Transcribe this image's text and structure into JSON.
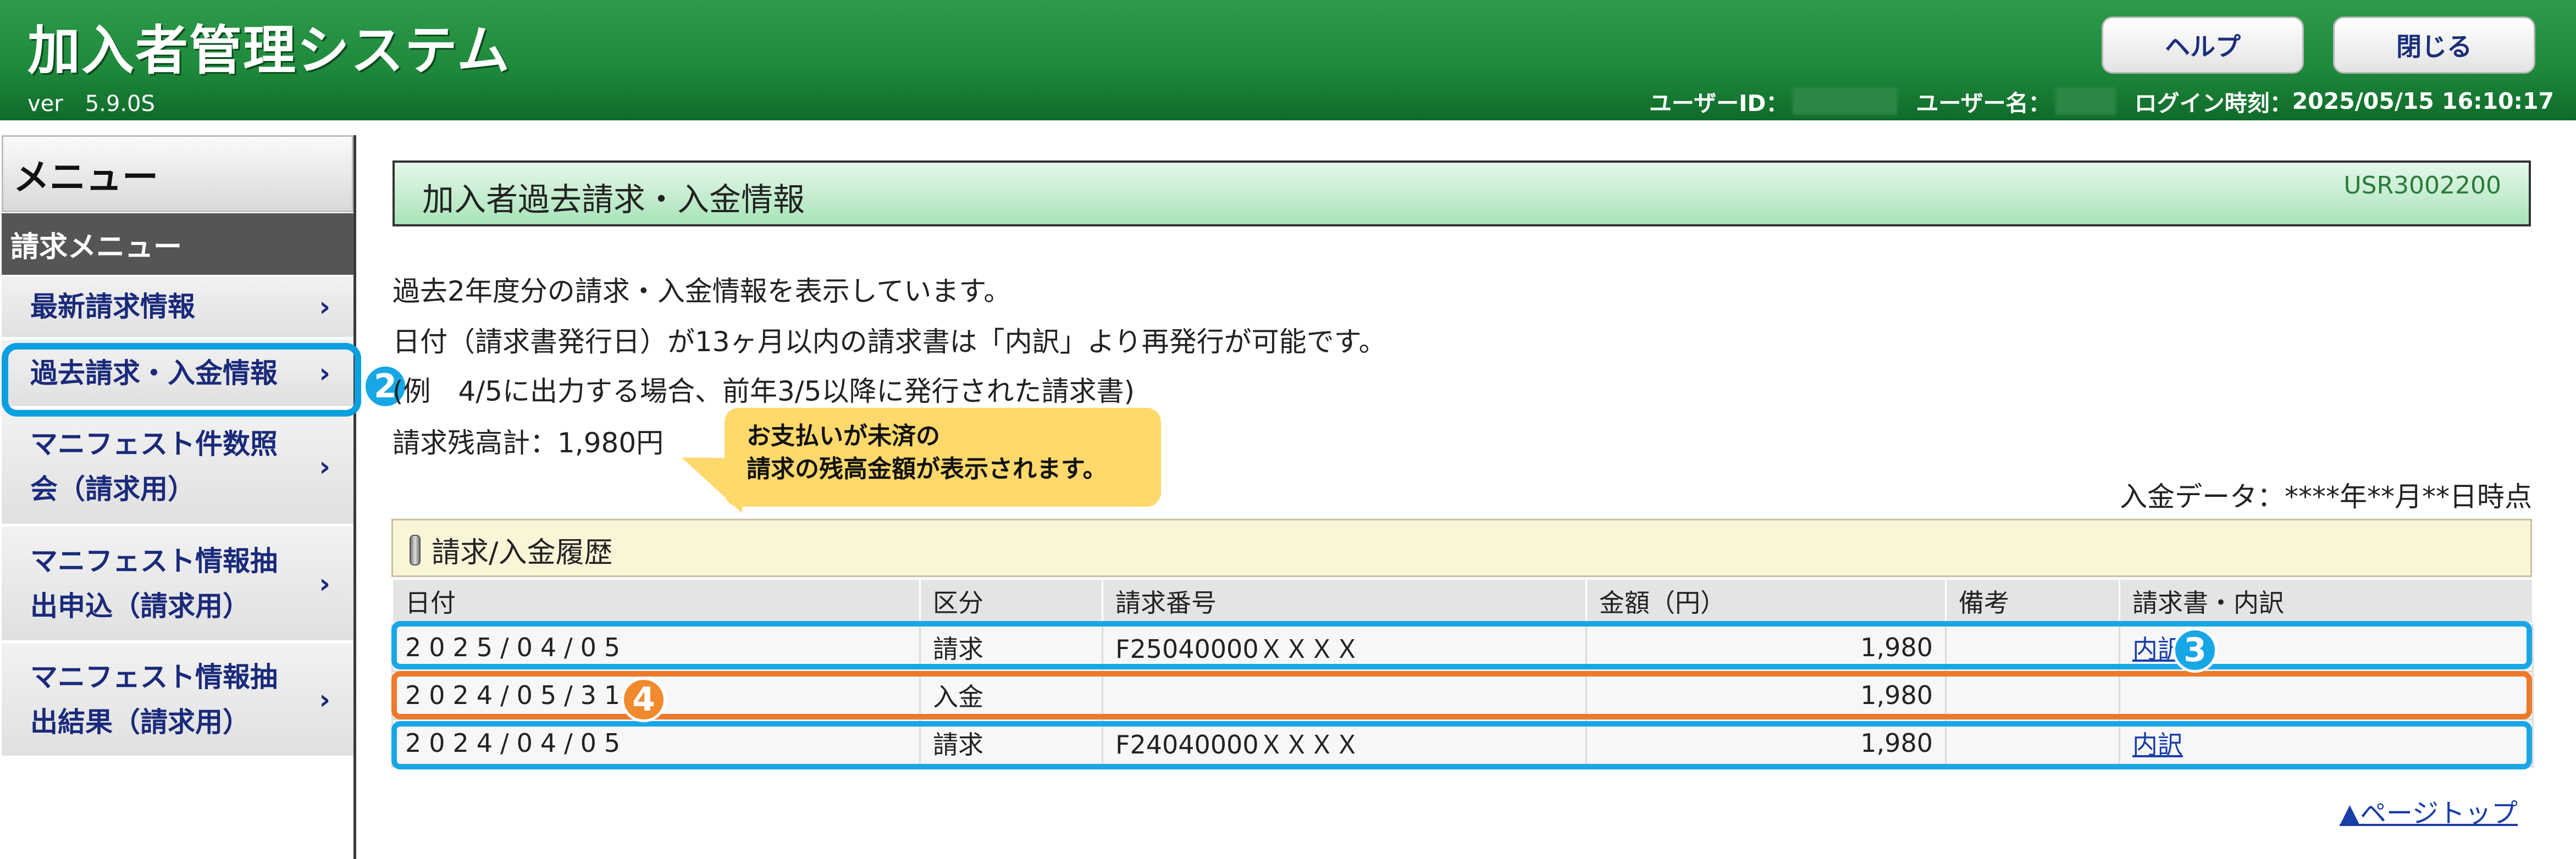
{
  "header": {
    "title": "加入者管理システム",
    "version": "ver　5.9.0S",
    "help_label": "ヘルプ",
    "close_label": "閉じる",
    "user_id_label": "ユーザーID：",
    "user_name_label": "ユーザー名：",
    "login_time_label": "ログイン時刻：",
    "login_time": "2025/05/15 16:10:17"
  },
  "sidebar": {
    "title": "メニュー",
    "section": "請求メニュー",
    "items": [
      {
        "label": "最新請求情報"
      },
      {
        "label": "過去請求・入金情報"
      },
      {
        "label": "マニフェスト件数照会（請求用）"
      },
      {
        "label": "マニフェスト情報抽出申込（請求用）"
      },
      {
        "label": "マニフェスト情報抽出結果（請求用）"
      }
    ],
    "chevron": "›"
  },
  "annotations": {
    "a2": "2",
    "a3": "3",
    "a4": "4"
  },
  "main": {
    "page_title": "加入者過去請求・入金情報",
    "screen_id": "USR3002200",
    "desc1": "過去2年度分の請求・入金情報を表示しています。",
    "desc2": "日付（請求書発行日）が13ヶ月以内の請求書は「内訳」より再発行が可能です。",
    "desc3": "(例　4/5に出力する場合、前年3/5以降に発行された請求書)",
    "balance": "請求残高計：1,980円",
    "tooltip_line1": "お支払いが未済の",
    "tooltip_line2": "請求の残高金額が表示されます。",
    "as_of": "入金データ：****年**月**日時点",
    "history_title": "請求/入金履歴",
    "page_top": "▲ページトップ"
  },
  "table": {
    "headers": [
      "日付",
      "区分",
      "請求番号",
      "金額（円）",
      "備考",
      "請求書・内訳"
    ],
    "rows": [
      {
        "date": "2025/04/05",
        "kubun": "請求",
        "invoice_no": "F25040000ＸＸＸＸ",
        "amount": "1,980",
        "note": "",
        "link": "内訳"
      },
      {
        "date": "2024/05/31",
        "kubun": "入金",
        "invoice_no": "",
        "amount": "1,980",
        "note": "",
        "link": ""
      },
      {
        "date": "2024/04/05",
        "kubun": "請求",
        "invoice_no": "F24040000ＸＸＸＸ",
        "amount": "1,980",
        "note": "",
        "link": "内訳"
      }
    ]
  },
  "colors": {
    "header_green": "#1f8a3c",
    "annotation_blue": "#18a7e6",
    "annotation_orange": "#ec7a2a",
    "tooltip_yellow": "#ffd96b",
    "link_blue": "#1a3ea8"
  }
}
